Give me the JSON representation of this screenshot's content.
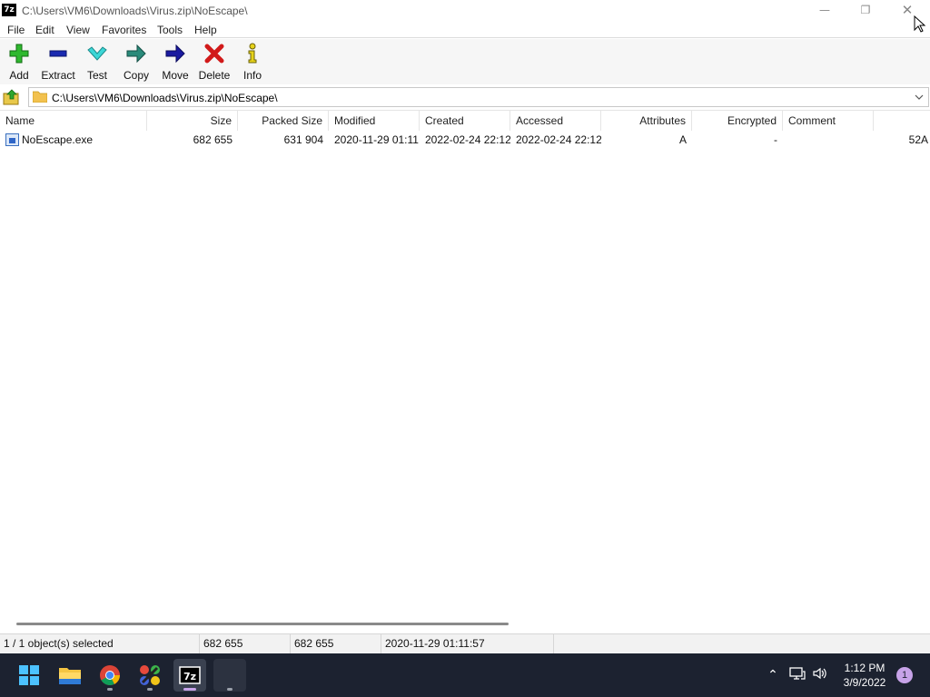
{
  "window": {
    "app_icon_text": "7z",
    "title": "C:\\Users\\VM6\\Downloads\\Virus.zip\\NoEscape\\"
  },
  "menu": [
    "File",
    "Edit",
    "View",
    "Favorites",
    "Tools",
    "Help"
  ],
  "toolbar": {
    "add": "Add",
    "extract": "Extract",
    "test": "Test",
    "copy": "Copy",
    "move": "Move",
    "delete": "Delete",
    "info": "Info"
  },
  "address": {
    "path": "C:\\Users\\VM6\\Downloads\\Virus.zip\\NoEscape\\"
  },
  "columns": [
    "Name",
    "Size",
    "Packed Size",
    "Modified",
    "Created",
    "Accessed",
    "Attributes",
    "Encrypted",
    "Comment"
  ],
  "files": [
    {
      "name": "NoEscape.exe",
      "size": "682 655",
      "packed_size": "631 904",
      "modified": "2020-11-29 01:11",
      "created": "2022-02-24 22:12",
      "accessed": "2022-02-24 22:12",
      "attributes": "A",
      "encrypted": "-",
      "comment": "",
      "crc_partial": "52A"
    }
  ],
  "status": {
    "selection": "1 / 1 object(s) selected",
    "size": "682 655",
    "packed": "682 655",
    "modified": "2020-11-29 01:11:57"
  },
  "taskbar": {
    "time": "1:12 PM",
    "date": "3/9/2022",
    "notifications": "1"
  }
}
